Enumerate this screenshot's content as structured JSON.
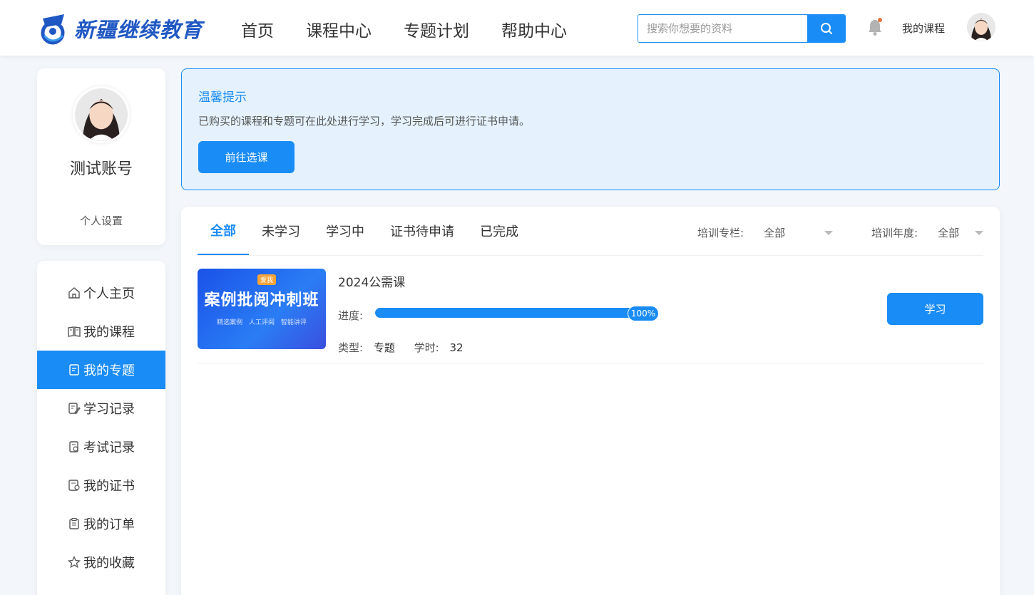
{
  "header": {
    "logo_text": "新疆继续教育",
    "nav": [
      "首页",
      "课程中心",
      "专题计划",
      "帮助中心"
    ],
    "search_placeholder": "搜索你想要的资料",
    "my_course": "我的课程"
  },
  "profile": {
    "username": "测试账号",
    "settings": "个人设置"
  },
  "menu": [
    {
      "label": "个人主页",
      "icon": "home-icon"
    },
    {
      "label": "我的课程",
      "icon": "book-icon"
    },
    {
      "label": "我的专题",
      "icon": "document-icon"
    },
    {
      "label": "学习记录",
      "icon": "edit-doc-icon"
    },
    {
      "label": "考试记录",
      "icon": "exam-icon"
    },
    {
      "label": "我的证书",
      "icon": "certificate-icon"
    },
    {
      "label": "我的订单",
      "icon": "clipboard-icon"
    },
    {
      "label": "我的收藏",
      "icon": "star-icon"
    }
  ],
  "tip": {
    "title": "温馨提示",
    "text": "已购买的课程和专题可在此处进行学习，学习完成后可进行证书申请。",
    "button": "前往选课"
  },
  "tabs": [
    "全部",
    "未学习",
    "学习中",
    "证书待申请",
    "已完成"
  ],
  "filters": [
    {
      "label": "培训专栏:",
      "value": "全部"
    },
    {
      "label": "培训年度:",
      "value": "全部"
    }
  ],
  "course": {
    "thumb_title": "案例批阅冲刺班",
    "thumb_tag": "爱我",
    "thumb_sub": "精选案例 人工评阅 智能讲评",
    "name": "2024公需课",
    "progress_label": "进度:",
    "progress_percent": 100,
    "progress_text": "100%",
    "type_label": "类型:",
    "type_value": "专题",
    "hours_label": "学时:",
    "hours_value": "32",
    "button": "学习"
  },
  "colors": {
    "primary": "#1a8cf5",
    "logo": "#1f57c3",
    "tip_bg": "#e5f2fd"
  }
}
